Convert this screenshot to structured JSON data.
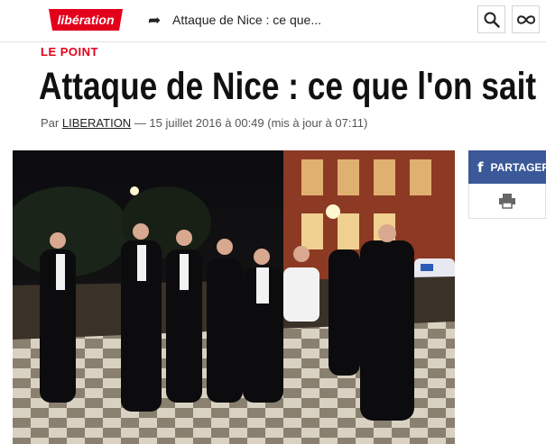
{
  "header": {
    "logo_text": "libération",
    "article_short_title": "Attaque de Nice : ce que...",
    "icons": {
      "share": "share-arrow-icon",
      "search": "search-icon",
      "menu": "infinity-menu-icon"
    }
  },
  "article": {
    "kicker": "LE POINT",
    "title": "Attaque de Nice : ce que l'on sait",
    "byline_prefix": "Par",
    "author": "LIBERATION",
    "date_text": " — 15 juillet 2016 à 00:49 (mis à jour à 07:11)"
  },
  "share": {
    "facebook_label": "PARTAGER",
    "print_icon": "printer-icon"
  },
  "colors": {
    "brand_red": "#e3001b",
    "facebook_blue": "#3b5998"
  }
}
